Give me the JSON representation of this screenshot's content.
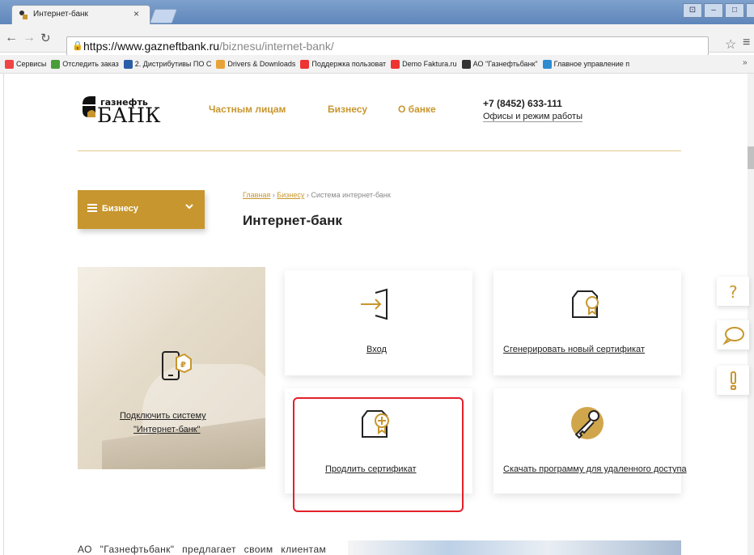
{
  "browser": {
    "tab_title": "Интернет-банк",
    "tab_close": "×",
    "url_host": "https://www.gazneftbank.ru",
    "url_path": "/biznesu/internet-bank/",
    "window_buttons": [
      "⊡",
      "–",
      "□",
      "x"
    ]
  },
  "bookmarks": [
    {
      "label": "Сервисы",
      "icon": "apps-grid-icon",
      "color": "#e44"
    },
    {
      "label": "Отследить заказ",
      "icon": "parcel-icon",
      "color": "#4a9e3a"
    },
    {
      "label": "2. Дистрибутивы ПО С",
      "icon": "x-logo-icon",
      "color": "#2a5fa8"
    },
    {
      "label": "Drivers & Downloads",
      "icon": "drv-icon",
      "color": "#e8a23a"
    },
    {
      "label": "Поддержка пользоват",
      "icon": "f-logo-icon",
      "color": "#e33"
    },
    {
      "label": "Demo Faktura.ru",
      "icon": "f-logo-icon",
      "color": "#e33"
    },
    {
      "label": "АО \"Газнефтьбанк\"",
      "icon": "bank-logo-icon",
      "color": "#333"
    },
    {
      "label": "Главное управление п",
      "icon": "ministry-icon",
      "color": "#2e8bd1"
    }
  ],
  "bookmarks_more": "»",
  "site": {
    "logo_top": "газнефть",
    "logo_bottom": "БАНК",
    "nav": [
      "Частным лицам",
      "Бизнесу",
      "О банке"
    ],
    "phone": "+7 (8452) 633-111",
    "offices": "Офисы и режим работы",
    "side_menu": "Бизнесу",
    "breadcrumb": {
      "home": "Главная",
      "sep": "›",
      "section": "Бизнесу",
      "current": "Система интернет-банк"
    },
    "title": "Интернет-банк",
    "promo": {
      "line1": "Подключить систему",
      "line2": "\"Интернет-банк\""
    },
    "cards": {
      "login": "Вход",
      "new_cert": "Сгенерировать новый сертификат",
      "renew_cert": "Продлить сертификат",
      "download": "Скачать программу для удаленного доступа"
    },
    "bottom_text": "АО \"Газнефтьбанк\" предлагает своим клиентам"
  },
  "colors": {
    "accent": "#c8962e",
    "highlight": "#e3202a"
  }
}
